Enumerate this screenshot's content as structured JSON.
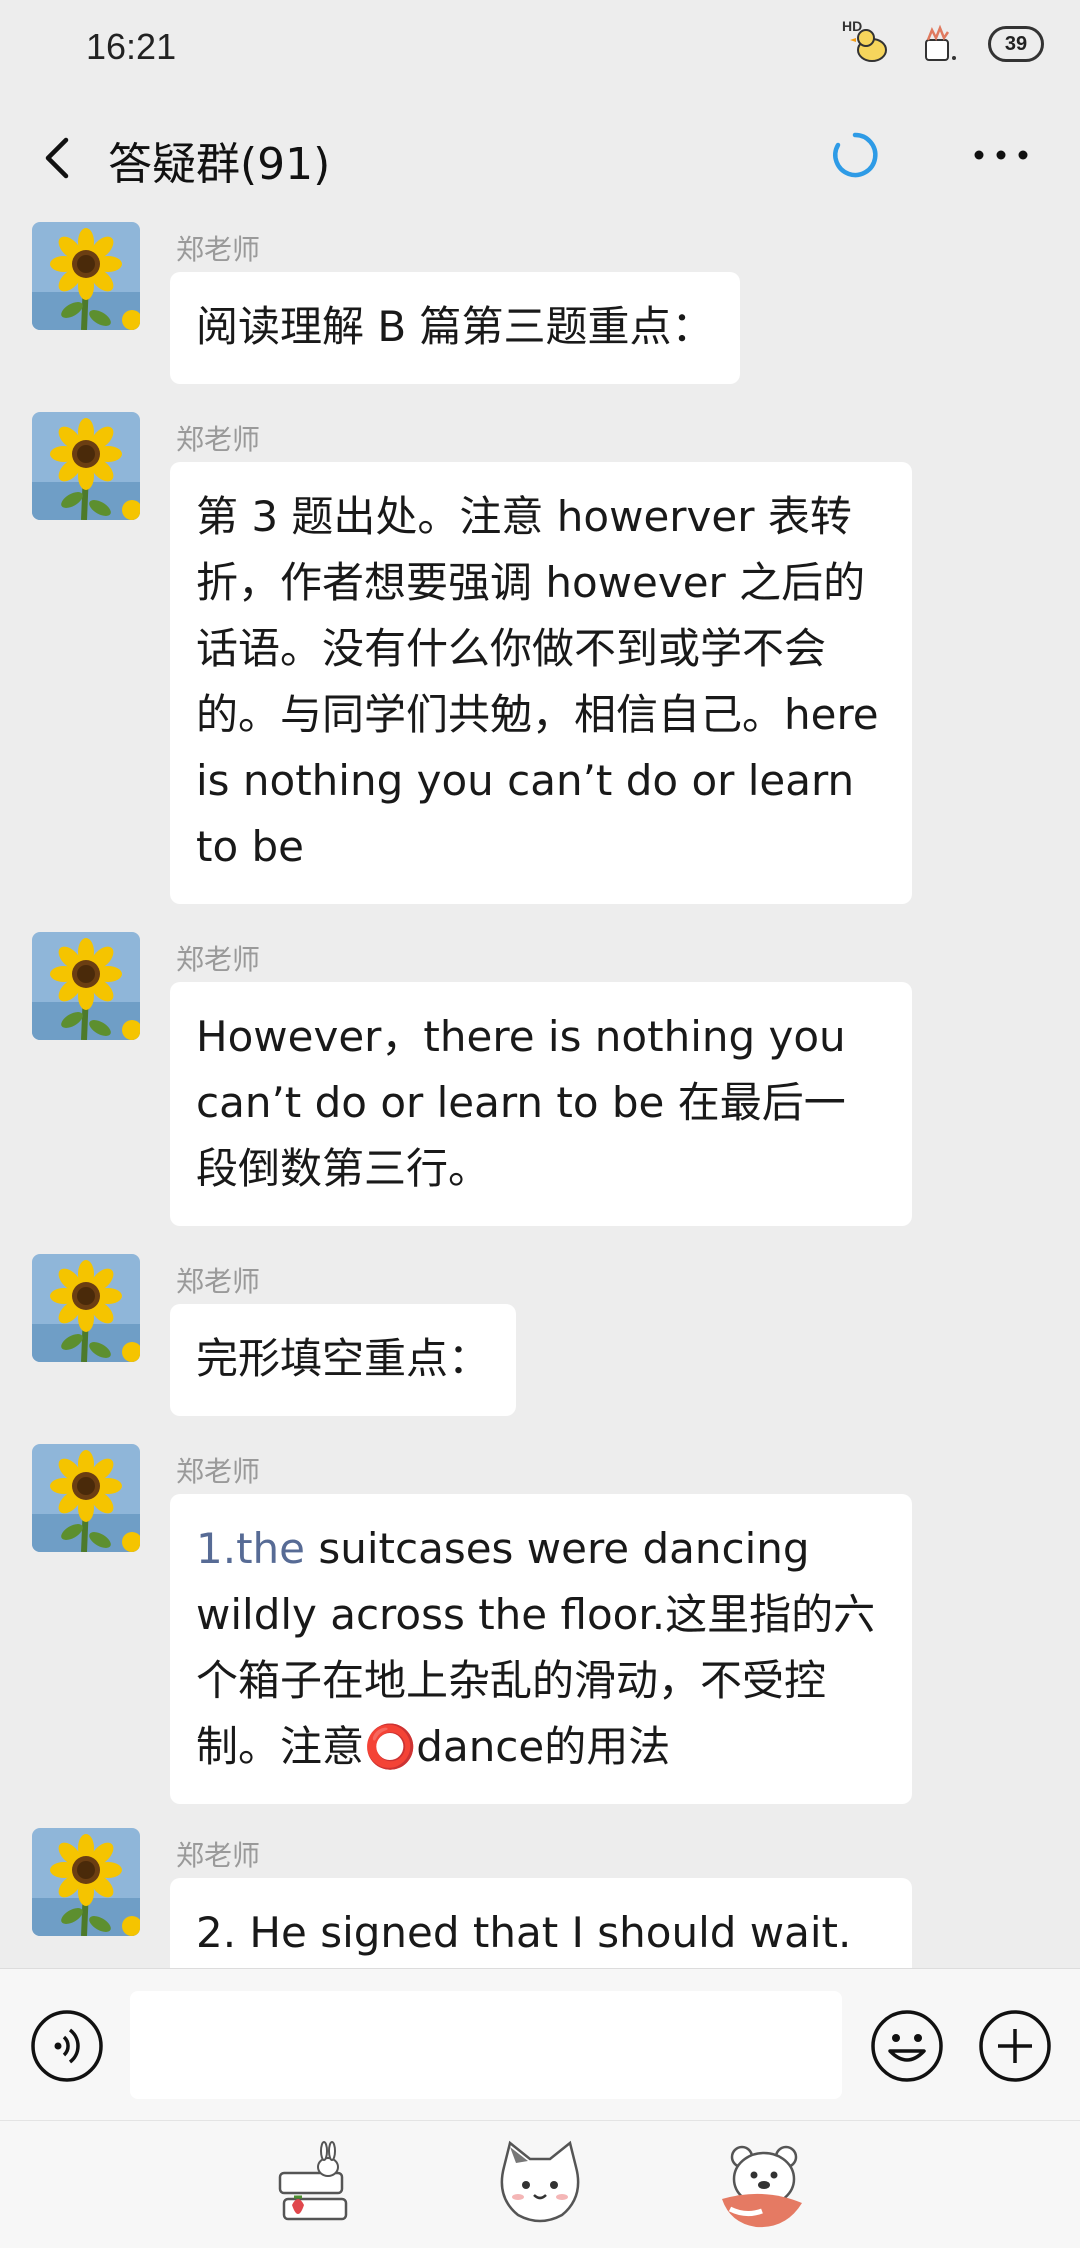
{
  "status": {
    "time": "16:21",
    "hd": "HD",
    "battery": "39"
  },
  "header": {
    "title": "答疑群(91)"
  },
  "messages": [
    {
      "sender": "郑老师",
      "text": "阅读理解 B 篇第三题重点："
    },
    {
      "sender": "郑老师",
      "text": "第 3 题出处。注意 howerver 表转折，作者想要强调 however 之后的话语。没有什么你做不到或学不会的。与同学们共勉，相信自己。here is nothing you can’t do or learn to be"
    },
    {
      "sender": "郑老师",
      "text": "However，there is nothing you can’t do or learn to be 在最后一段倒数第三行。"
    },
    {
      "sender": "郑老师",
      "text": "完形填空重点："
    },
    {
      "sender": "郑老师",
      "link": "1.the",
      "text": " suitcases were dancing wildly across the floor.这里指的六个箱子在地上杂乱的滑动，不受控制。注意⭕dance的用法"
    },
    {
      "sender": "郑老师",
      "text": "2. He signed  that I should wait."
    }
  ],
  "input": {
    "placeholder": ""
  },
  "colors": {
    "background": "#ededed",
    "bubble": "#ffffff",
    "link": "#576b95",
    "loading": "#2e9be6"
  },
  "icons": {
    "back": "back-arrow-icon",
    "loading": "loading-spinner-icon",
    "more": "more-dots-icon",
    "voice": "voice-icon",
    "emoji": "emoji-icon",
    "plus": "plus-icon",
    "stickers": [
      "rabbit-sticker-icon",
      "cat-sticker-icon",
      "bear-sticker-icon"
    ]
  }
}
